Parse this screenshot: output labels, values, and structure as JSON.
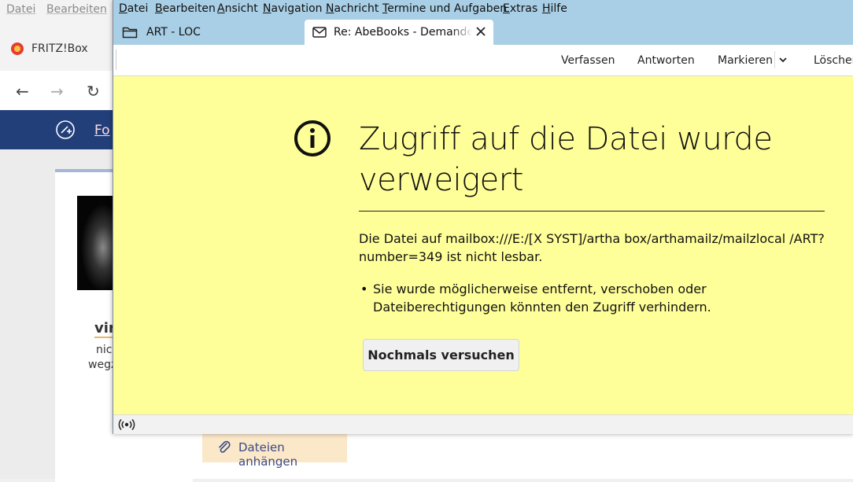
{
  "background_browser": {
    "menu": [
      "Datei",
      "Bearbeiten"
    ],
    "tab_title": "FRITZ!Box",
    "nav_link": "Fo",
    "profile_name": "vir",
    "profile_line1": "nic",
    "profile_line2": "wegz",
    "attach_label": "Dateien anhängen"
  },
  "thunderbird": {
    "menu": [
      "Datei",
      "Bearbeiten",
      "Ansicht",
      "Navigation",
      "Nachricht",
      "Termine und Aufgaben",
      "Extras",
      "Hilfe"
    ],
    "tabs": [
      {
        "label": "ART - LOC",
        "icon": "folder-icon"
      },
      {
        "label": "Re: AbeBooks - Demande de",
        "icon": "mail-icon"
      }
    ],
    "toolbar": {
      "compose": "Verfassen",
      "reply": "Antworten",
      "mark": "Markieren",
      "delete": "Löschen"
    },
    "error": {
      "title": "Zugriff auf die Datei wurde verweigert",
      "message": "Die Datei auf mailbox:///E:/[X SYST]/artha box/arthamailz/mailzlocal /ART?number=349 ist nicht lesbar.",
      "reasons": [
        "Sie wurde möglicherweise entfernt, verschoben oder Dateiberechtigungen könnten den Zugriff verhindern."
      ],
      "retry_label": "Nochmals versuchen"
    }
  },
  "colors": {
    "error_background": "#ffff99",
    "title_bar": "#a9cfe6",
    "fritz_header": "#233f7a"
  }
}
